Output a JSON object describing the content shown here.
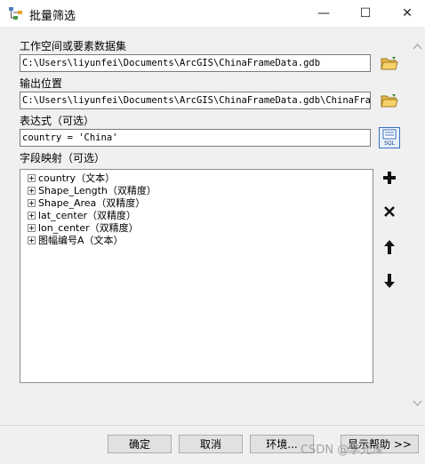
{
  "window": {
    "title": "批量筛选",
    "minimize_glyph": "—",
    "maximize_glyph": "☐",
    "close_glyph": "✕"
  },
  "fields": {
    "workspace": {
      "label": "工作空间或要素数据集",
      "value": "C:\\Users\\liyunfei\\Documents\\ArcGIS\\ChinaFrameData.gdb"
    },
    "output": {
      "label": "输出位置",
      "value": "C:\\Users\\liyunfei\\Documents\\ArcGIS\\ChinaFrameData.gdb\\ChinaFrame"
    },
    "expression": {
      "label": "表达式（可选）",
      "value": "country = 'China'"
    },
    "mapping": {
      "label": "字段映射（可选）"
    }
  },
  "field_mapping_items": [
    {
      "label": "country（文本）"
    },
    {
      "label": "Shape_Length（双精度）"
    },
    {
      "label": "Shape_Area（双精度）"
    },
    {
      "label": "lat_center（双精度）"
    },
    {
      "label": "lon_center（双精度）"
    },
    {
      "label": "图幅编号A（文本）"
    }
  ],
  "side_buttons": {
    "sql_label": "SQL"
  },
  "footer": {
    "ok": "确定",
    "cancel": "取消",
    "env": "环境...",
    "help": "显示帮助 >>",
    "watermark": "CSDN @李允深"
  },
  "icons": [
    "app-icon",
    "folder-icon",
    "sql-icon",
    "plus-icon",
    "delete-icon",
    "arrow-up-icon",
    "arrow-down-icon"
  ],
  "colors": {
    "folder": "#e8b84a",
    "sql_border": "#3a6fc0"
  }
}
